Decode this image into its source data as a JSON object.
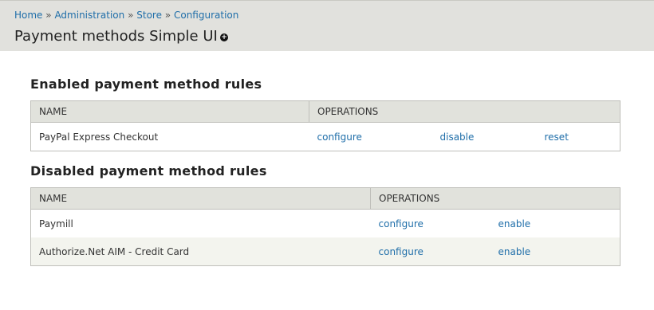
{
  "breadcrumb": [
    {
      "label": "Home"
    },
    {
      "label": "Administration"
    },
    {
      "label": "Store"
    },
    {
      "label": "Configuration"
    }
  ],
  "breadcrumb_separator": "»",
  "page_title": "Payment methods Simple UI",
  "add_icon_glyph": "+",
  "enabled_section": {
    "title": "Enabled payment method rules",
    "columns": [
      "NAME",
      "OPERATIONS"
    ],
    "rows": [
      {
        "name": "PayPal Express Checkout",
        "ops": [
          "configure",
          "disable",
          "reset"
        ]
      }
    ]
  },
  "disabled_section": {
    "title": "Disabled payment method rules",
    "columns": [
      "NAME",
      "OPERATIONS"
    ],
    "rows": [
      {
        "name": "Paymill",
        "ops": [
          "configure",
          "enable"
        ]
      },
      {
        "name": "Authorize.Net AIM - Credit Card",
        "ops": [
          "configure",
          "enable"
        ]
      }
    ]
  },
  "colors": {
    "link": "#1f6ea9",
    "header_bg": "#e1e1dd",
    "table_header_bg": "#e1e2dc",
    "even_row_bg": "#f3f4ee"
  }
}
